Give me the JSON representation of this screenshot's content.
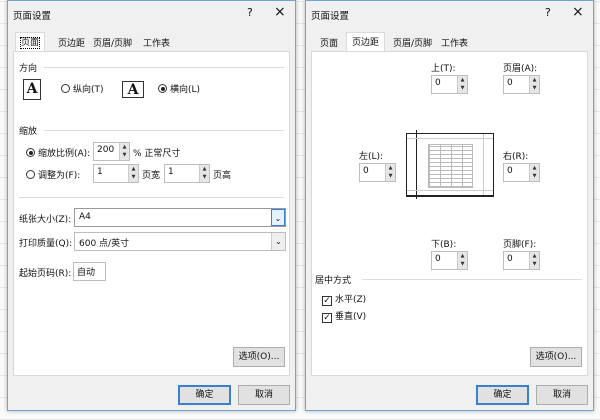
{
  "left": {
    "title": "页面设置",
    "help": "?",
    "close": "×",
    "tabs": [
      "页面",
      "页边距",
      "页眉/页脚",
      "工作表"
    ],
    "orientation": {
      "label": "方向",
      "portrait": "纵向(T)",
      "landscape": "横向(L)",
      "selected": "landscape",
      "icon_letter": "A"
    },
    "scaling": {
      "label": "缩放",
      "adjust_label": "缩放比例(A):",
      "adjust_value": "200",
      "adjust_suffix": "% 正常尺寸",
      "fit_label": "调整为(F):",
      "fit_wide": "1",
      "wide_label": "页宽",
      "fit_tall": "1",
      "tall_label": "页高",
      "selected": "adjust"
    },
    "paper_size": {
      "label": "纸张大小(Z):",
      "value": "A4"
    },
    "print_quality": {
      "label": "打印质量(Q):",
      "value": "600 点/英寸"
    },
    "first_page": {
      "label": "起始页码(R):",
      "value": "自动"
    },
    "options": "选项(O)...",
    "ok": "确定",
    "cancel": "取消"
  },
  "right": {
    "title": "页面设置",
    "help": "?",
    "close": "×",
    "tabs": [
      "页面",
      "页边距",
      "页眉/页脚",
      "工作表"
    ],
    "top": {
      "label": "上(T):",
      "value": "0"
    },
    "header": {
      "label": "页眉(A):",
      "value": "0"
    },
    "left": {
      "label": "左(L):",
      "value": "0"
    },
    "right": {
      "label": "右(R):",
      "value": "0"
    },
    "bottom": {
      "label": "下(B):",
      "value": "0"
    },
    "footer": {
      "label": "页脚(F):",
      "value": "0"
    },
    "center": {
      "label": "居中方式",
      "horizontal": "水平(Z)",
      "vertical": "垂直(V)",
      "horizontal_checked": true,
      "vertical_checked": true
    },
    "options": "选项(O)...",
    "ok": "确定",
    "cancel": "取消"
  }
}
